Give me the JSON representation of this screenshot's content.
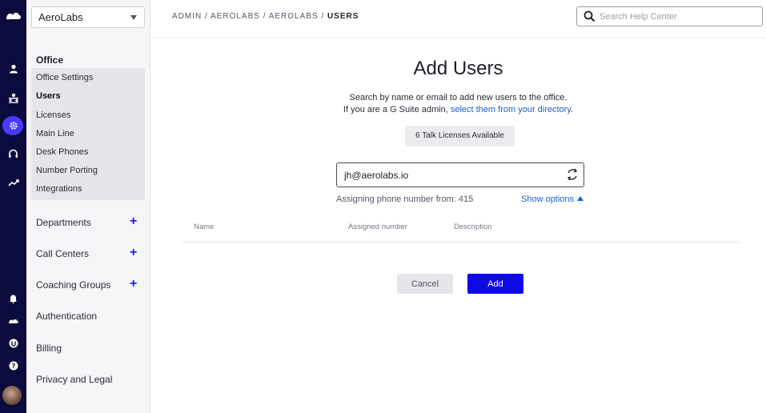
{
  "rail": {
    "icons": [
      "logo-icon",
      "person-icon",
      "contact-center-icon",
      "gear-icon",
      "headset-icon",
      "analytics-icon",
      "bell-icon",
      "logo-small-icon",
      "shield-icon",
      "help-icon"
    ]
  },
  "sidebar": {
    "office_select": "AeroLabs",
    "section_title": "Office",
    "sub_items": [
      {
        "label": "Office Settings",
        "active": false
      },
      {
        "label": "Users",
        "active": true
      },
      {
        "label": "Licenses",
        "active": false
      },
      {
        "label": "Main Line",
        "active": false
      },
      {
        "label": "Desk Phones",
        "active": false
      },
      {
        "label": "Number Porting",
        "active": false
      },
      {
        "label": "Integrations",
        "active": false
      }
    ],
    "nav_items": [
      {
        "label": "Departments",
        "has_add": true
      },
      {
        "label": "Call Centers",
        "has_add": true
      },
      {
        "label": "Coaching Groups",
        "has_add": true
      },
      {
        "label": "Authentication",
        "has_add": false
      },
      {
        "label": "Billing",
        "has_add": false
      },
      {
        "label": "Privacy and Legal",
        "has_add": false
      }
    ],
    "add_symbol": "+"
  },
  "header": {
    "breadcrumb_path": "ADMIN / AEROLABS / AEROLABS / ",
    "breadcrumb_current": "USERS",
    "search_placeholder": "Search Help Center"
  },
  "main": {
    "title": "Add Users",
    "description_line1": "Search by name or email to add new users to the office.",
    "description_line2_prefix": "If you are a G Suite admin, ",
    "description_line2_link": "select them from your directory",
    "description_line2_suffix": ".",
    "licenses_label": "6 Talk Licenses Available",
    "user_input_value": "jh@aerolabs.io",
    "assign_text": "Assigning phone number from: 415",
    "show_options_label": "Show options",
    "table_headers": [
      "Name",
      "Assigned number",
      "Description"
    ],
    "cancel_label": "Cancel",
    "add_label": "Add"
  },
  "colors": {
    "rail_bg": "#0c0b3e",
    "accent": "#0e08e8",
    "link": "#1a5fd6"
  }
}
